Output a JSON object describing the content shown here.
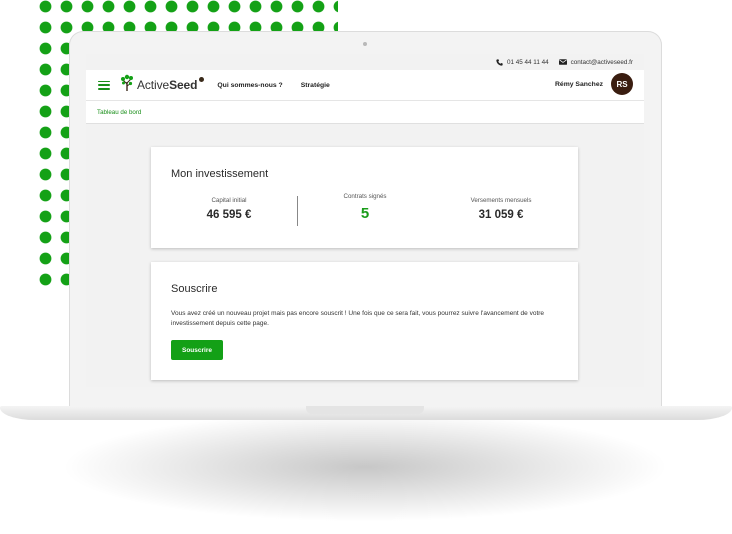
{
  "topbar": {
    "phone": "01 45 44 11 44",
    "email": "contact@activeseed.fr"
  },
  "nav": {
    "brand_light": "Active",
    "brand_bold": "Seed",
    "links": [
      "Qui sommes-nous ?",
      "Stratégie"
    ],
    "user_name": "Rémy Sanchez",
    "user_initials": "RS"
  },
  "breadcrumb": "Tableau de bord",
  "investment": {
    "title": "Mon investissement",
    "stats": [
      {
        "label": "Capital initial",
        "value": "46 595 €"
      },
      {
        "label": "Contrats signés",
        "value": "5"
      },
      {
        "label": "Versements mensuels",
        "value": "31 059 €"
      }
    ]
  },
  "subscribe": {
    "title": "Souscrire",
    "description": "Vous avez créé un nouveau projet mais pas encore souscrit ! Une fois que ce sera fait, vous pourrez suivre l'avancement de votre investissement depuis cette page.",
    "button_label": "Souscrire"
  },
  "colors": {
    "brand_green": "#13a016",
    "avatar_brown": "#3a1d10"
  },
  "icons": [
    "phone-icon",
    "mail-icon",
    "menu-icon",
    "tree-logo-icon"
  ]
}
